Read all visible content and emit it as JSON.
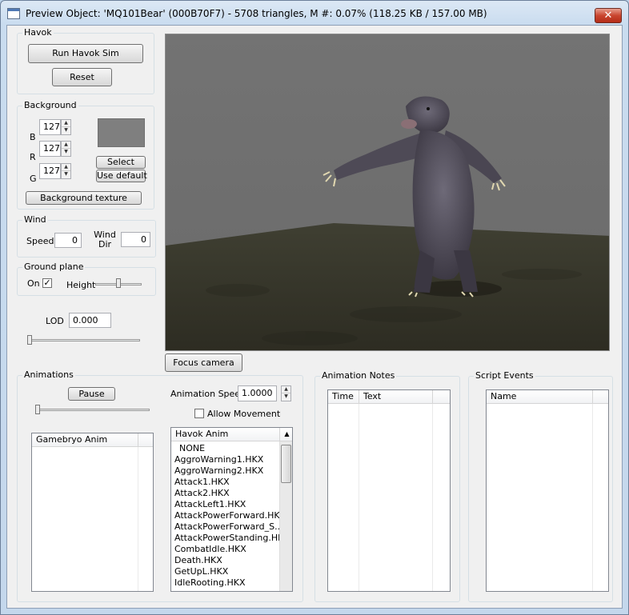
{
  "window": {
    "title": "Preview Object: 'MQ101Bear' (000B70F7) - 5708 triangles, M #: 0.07% (118.25 KB / 157.00 MB)",
    "close_glyph": "✕"
  },
  "havok": {
    "group_label": "Havok",
    "run_label": "Run Havok Sim",
    "reset_label": "Reset"
  },
  "background": {
    "group_label": "Background",
    "b_label": "B",
    "r_label": "R",
    "g_label": "G",
    "b_value": "127",
    "r_value": "127",
    "g_value": "127",
    "select_label": "Select",
    "use_default_label": "Use default",
    "texture_label": "Background texture",
    "swatch_color": "#7f7f7f"
  },
  "wind": {
    "group_label": "Wind",
    "speed_label": "Speed",
    "speed_value": "0",
    "dir_label": "Wind Dir",
    "dir_value": "0"
  },
  "ground": {
    "group_label": "Ground plane",
    "on_label": "On",
    "on_checked": "✓",
    "height_label": "Height",
    "height_level": 0.5
  },
  "lod": {
    "label": "LOD",
    "value": "0.000",
    "level": 0.0
  },
  "viewport": {
    "focus_label": "Focus camera"
  },
  "animations": {
    "group_label": "Animations",
    "pause_label": "Pause",
    "speed_label": "Animation Speed",
    "speed_value": "1.0000",
    "allow_movement_label": "Allow Movement",
    "gamebryo_header": "Gamebryo Anim",
    "havok_header": "Havok Anim",
    "havok_items": [
      "NONE",
      "AggroWarning1.HKX",
      "AggroWarning2.HKX",
      "Attack1.HKX",
      "Attack2.HKX",
      "AttackLeft1.HKX",
      "AttackPowerForward.HKX",
      "AttackPowerForward_S...",
      "AttackPowerStanding.HKX",
      "CombatIdle.HKX",
      "Death.HKX",
      "GetUpL.HKX",
      "IdleRooting.HKX"
    ]
  },
  "notes": {
    "group_label": "Animation Notes",
    "time_header": "Time",
    "text_header": "Text"
  },
  "events": {
    "group_label": "Script Events",
    "name_header": "Name"
  }
}
